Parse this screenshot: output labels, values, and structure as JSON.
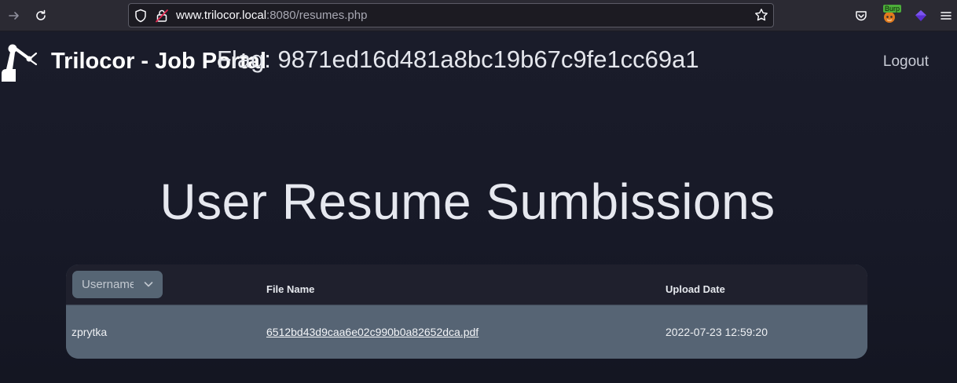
{
  "browser": {
    "url_host": "www.trilocor.local",
    "url_rest": ":8080/resumes.php",
    "extension_badge": "Burp"
  },
  "header": {
    "brand": "Trilocor - Job Portal",
    "flag": "Flag: 9871ed16d481a8bc19b67c9fe1cc69a1",
    "logout": "Logout"
  },
  "main": {
    "heading": "User Resume Sumbissions"
  },
  "table": {
    "username_select": "Username",
    "columns": [
      "File Name",
      "Upload Date"
    ],
    "rows": [
      {
        "username": "zprytka",
        "file": "6512bd43d9caa6e02c990b0a82652dca.pdf",
        "date": "2022-07-23 12:59:20"
      }
    ]
  }
}
